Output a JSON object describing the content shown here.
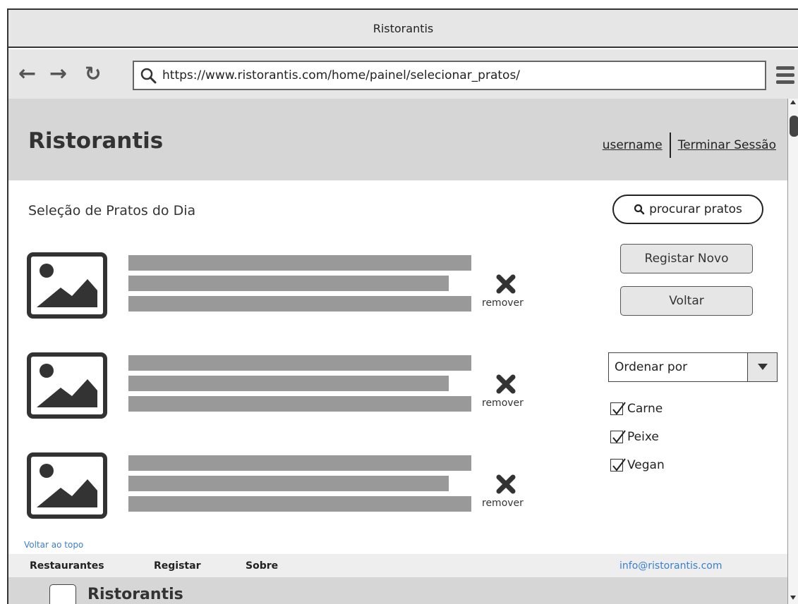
{
  "window": {
    "title": "Ristorantis"
  },
  "browser": {
    "url": "https://www.ristorantis.com/home/painel/selecionar_pratos/",
    "back_icon": "arrow-left-icon",
    "forward_icon": "arrow-right-icon",
    "reload_icon": "reload-icon"
  },
  "header": {
    "brand": "Ristorantis",
    "username": "username",
    "logout": "Terminar Sessão"
  },
  "main": {
    "title": "Seleção de Pratos do Dia",
    "search_label": "procurar pratos",
    "register_button": "Registar Novo",
    "back_button": "Voltar",
    "dishes": [
      {
        "remove_label": "remover"
      },
      {
        "remove_label": "remover"
      },
      {
        "remove_label": "remover"
      }
    ],
    "sort": {
      "selected": "Ordenar por"
    },
    "filters": [
      {
        "label": "Carne",
        "checked": true
      },
      {
        "label": "Peixe",
        "checked": true
      },
      {
        "label": "Vegan",
        "checked": true
      }
    ],
    "back_to_top": "Voltar ao topo"
  },
  "footer": {
    "links": [
      "Restaurantes",
      "Registar",
      "Sobre"
    ],
    "email": "info@ristorantis.com",
    "brand": "Ristorantis"
  },
  "colors": {
    "link_blue": "#3a7fd0",
    "header_gray": "#d6d6d6",
    "placeholder_bar": "#999999"
  }
}
